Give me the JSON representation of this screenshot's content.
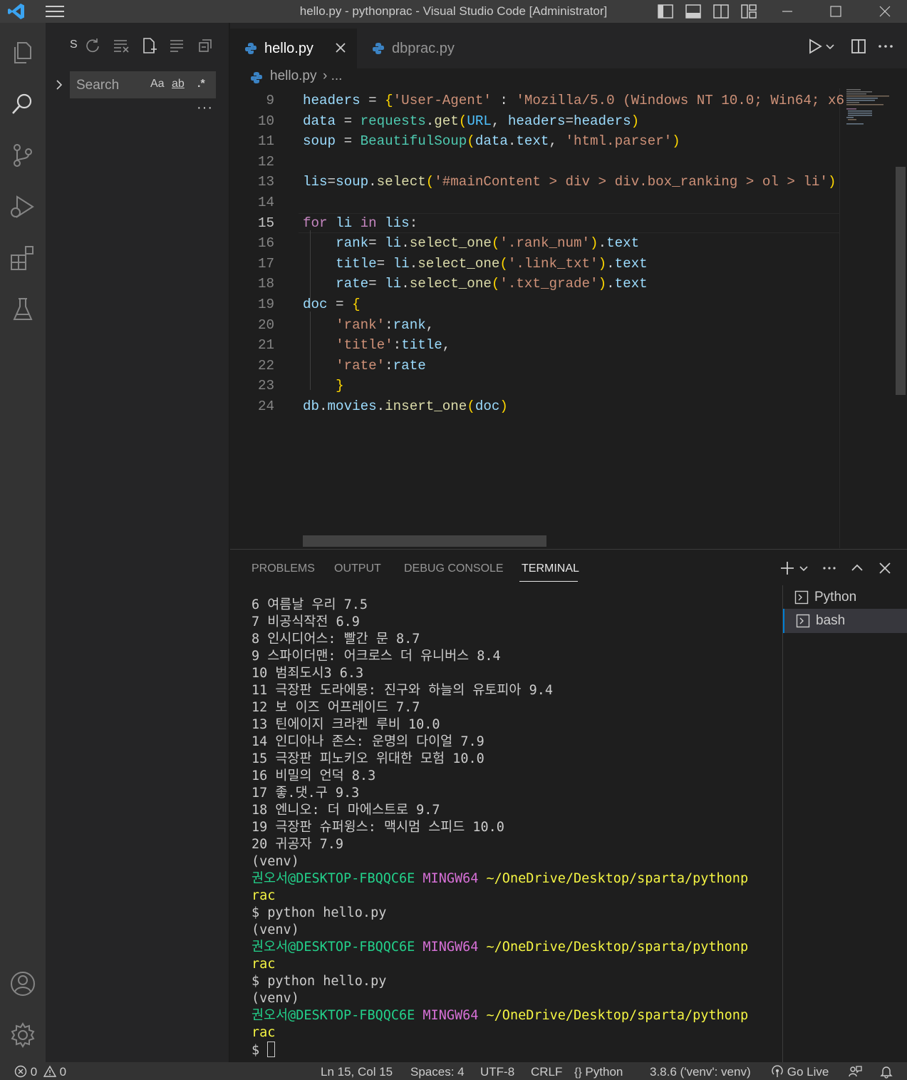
{
  "window": {
    "title": "hello.py - pythonprac - Visual Studio Code [Administrator]"
  },
  "sidebar": {
    "header_letter": "S",
    "search": {
      "placeholder": "Search",
      "value": "",
      "match_case": "Aa",
      "whole_word": "ab",
      "regex": ".*"
    },
    "more": "···"
  },
  "tabs": [
    {
      "label": "hello.py",
      "active": true
    },
    {
      "label": "dbprac.py",
      "active": false
    }
  ],
  "breadcrumb": {
    "file": "hello.py",
    "sep": "› ..."
  },
  "editor": {
    "current_line": 15,
    "lines": [
      {
        "n": "9",
        "tokens": [
          [
            "var",
            "headers"
          ],
          [
            "op",
            " = "
          ],
          [
            "brk1",
            "{"
          ],
          [
            "str",
            "'User-Agent'"
          ],
          [
            "op",
            " : "
          ],
          [
            "str",
            "'Mozilla/5.0 (Windows NT 10.0; Win64; x6"
          ]
        ]
      },
      {
        "n": "10",
        "tokens": [
          [
            "var",
            "data"
          ],
          [
            "op",
            " = "
          ],
          [
            "cls",
            "requests"
          ],
          [
            "op",
            "."
          ],
          [
            "fn",
            "get"
          ],
          [
            "brk1",
            "("
          ],
          [
            "const",
            "URL"
          ],
          [
            "op",
            ", "
          ],
          [
            "var",
            "headers"
          ],
          [
            "op",
            "="
          ],
          [
            "var",
            "headers"
          ],
          [
            "brk1",
            ")"
          ]
        ]
      },
      {
        "n": "11",
        "tokens": [
          [
            "var",
            "soup"
          ],
          [
            "op",
            " = "
          ],
          [
            "cls",
            "BeautifulSoup"
          ],
          [
            "brk1",
            "("
          ],
          [
            "var",
            "data"
          ],
          [
            "op",
            "."
          ],
          [
            "var",
            "text"
          ],
          [
            "op",
            ", "
          ],
          [
            "str",
            "'html.parser'"
          ],
          [
            "brk1",
            ")"
          ]
        ]
      },
      {
        "n": "12",
        "tokens": []
      },
      {
        "n": "13",
        "tokens": [
          [
            "var",
            "lis"
          ],
          [
            "op",
            "="
          ],
          [
            "var",
            "soup"
          ],
          [
            "op",
            "."
          ],
          [
            "fn",
            "select"
          ],
          [
            "brk1",
            "("
          ],
          [
            "str",
            "'#mainContent > div > div.box_ranking > ol > li'"
          ],
          [
            "brk1",
            ")"
          ]
        ]
      },
      {
        "n": "14",
        "tokens": []
      },
      {
        "n": "15",
        "tokens": [
          [
            "kw",
            "for"
          ],
          [
            "op",
            " "
          ],
          [
            "var",
            "li"
          ],
          [
            "op",
            " "
          ],
          [
            "kw",
            "in"
          ],
          [
            "op",
            " "
          ],
          [
            "var",
            "lis"
          ],
          [
            "op",
            ":"
          ]
        ]
      },
      {
        "n": "16",
        "tokens": [
          [
            "op",
            "    "
          ],
          [
            "var",
            "rank"
          ],
          [
            "op",
            "= "
          ],
          [
            "var",
            "li"
          ],
          [
            "op",
            "."
          ],
          [
            "fn",
            "select_one"
          ],
          [
            "brk1",
            "("
          ],
          [
            "str",
            "'.rank_num'"
          ],
          [
            "brk1",
            ")"
          ],
          [
            "op",
            "."
          ],
          [
            "var",
            "text"
          ]
        ]
      },
      {
        "n": "17",
        "tokens": [
          [
            "op",
            "    "
          ],
          [
            "var",
            "title"
          ],
          [
            "op",
            "= "
          ],
          [
            "var",
            "li"
          ],
          [
            "op",
            "."
          ],
          [
            "fn",
            "select_one"
          ],
          [
            "brk1",
            "("
          ],
          [
            "str",
            "'.link_txt'"
          ],
          [
            "brk1",
            ")"
          ],
          [
            "op",
            "."
          ],
          [
            "var",
            "text"
          ]
        ]
      },
      {
        "n": "18",
        "tokens": [
          [
            "op",
            "    "
          ],
          [
            "var",
            "rate"
          ],
          [
            "op",
            "= "
          ],
          [
            "var",
            "li"
          ],
          [
            "op",
            "."
          ],
          [
            "fn",
            "select_one"
          ],
          [
            "brk1",
            "("
          ],
          [
            "str",
            "'.txt_grade'"
          ],
          [
            "brk1",
            ")"
          ],
          [
            "op",
            "."
          ],
          [
            "var",
            "text"
          ]
        ]
      },
      {
        "n": "19",
        "tokens": [
          [
            "var",
            "doc"
          ],
          [
            "op",
            " = "
          ],
          [
            "brk1",
            "{"
          ]
        ]
      },
      {
        "n": "20",
        "tokens": [
          [
            "op",
            "    "
          ],
          [
            "str",
            "'rank'"
          ],
          [
            "op",
            ":"
          ],
          [
            "var",
            "rank"
          ],
          [
            "op",
            ","
          ]
        ]
      },
      {
        "n": "21",
        "tokens": [
          [
            "op",
            "    "
          ],
          [
            "str",
            "'title'"
          ],
          [
            "op",
            ":"
          ],
          [
            "var",
            "title"
          ],
          [
            "op",
            ","
          ]
        ]
      },
      {
        "n": "22",
        "tokens": [
          [
            "op",
            "    "
          ],
          [
            "str",
            "'rate'"
          ],
          [
            "op",
            ":"
          ],
          [
            "var",
            "rate"
          ]
        ]
      },
      {
        "n": "23",
        "tokens": [
          [
            "op",
            "    "
          ],
          [
            "brk1",
            "}"
          ]
        ]
      },
      {
        "n": "24",
        "tokens": [
          [
            "var",
            "db"
          ],
          [
            "op",
            "."
          ],
          [
            "var",
            "movies"
          ],
          [
            "op",
            "."
          ],
          [
            "fn",
            "insert_one"
          ],
          [
            "brk1",
            "("
          ],
          [
            "var",
            "doc"
          ],
          [
            "brk1",
            ")"
          ]
        ]
      }
    ]
  },
  "panel": {
    "tabs": [
      "PROBLEMS",
      "OUTPUT",
      "DEBUG CONSOLE",
      "TERMINAL"
    ],
    "active_tab": "TERMINAL",
    "terminal_lines": [
      [
        [
          "",
          "6 여름날 우리 7.5"
        ]
      ],
      [
        [
          "",
          "7 비공식작전 6.9"
        ]
      ],
      [
        [
          "",
          "8 인시디어스: 빨간 문 8.7"
        ]
      ],
      [
        [
          "",
          "9 스파이더맨: 어크로스 더 유니버스 8.4"
        ]
      ],
      [
        [
          "",
          "10 범죄도시3 6.3"
        ]
      ],
      [
        [
          "",
          "11 극장판 도라에몽: 진구와 하늘의 유토피아 9.4"
        ]
      ],
      [
        [
          "",
          "12 보 이즈 어프레이드 7.7"
        ]
      ],
      [
        [
          "",
          "13 틴에이지 크라켄 루비 10.0"
        ]
      ],
      [
        [
          "",
          "14 인디아나 존스: 운명의 다이얼 7.9"
        ]
      ],
      [
        [
          "",
          "15 극장판 피노키오 위대한 모험 10.0"
        ]
      ],
      [
        [
          "",
          "16 비밀의 언덕 8.3"
        ]
      ],
      [
        [
          "",
          "17 좋.댓.구 9.3"
        ]
      ],
      [
        [
          "",
          "18 엔니오: 더 마에스트로 9.7"
        ]
      ],
      [
        [
          "",
          "19 극장판 슈퍼윙스: 맥시멈 스피드 10.0"
        ]
      ],
      [
        [
          "",
          "20 귀공자 7.9"
        ]
      ],
      [
        [
          "",
          "(venv)"
        ]
      ],
      [
        [
          "t-green",
          "권오서@DESKTOP-FBQQC6E"
        ],
        [
          "",
          " "
        ],
        [
          "t-mag",
          "MINGW64"
        ],
        [
          "",
          " "
        ],
        [
          "t-yel",
          "~/OneDrive/Desktop/sparta/pythonp"
        ]
      ],
      [
        [
          "t-yel",
          "rac"
        ]
      ],
      [
        [
          "",
          "$ python hello.py"
        ]
      ],
      [
        [
          "",
          "(venv)"
        ]
      ],
      [
        [
          "t-green",
          "권오서@DESKTOP-FBQQC6E"
        ],
        [
          "",
          " "
        ],
        [
          "t-mag",
          "MINGW64"
        ],
        [
          "",
          " "
        ],
        [
          "t-yel",
          "~/OneDrive/Desktop/sparta/pythonp"
        ]
      ],
      [
        [
          "t-yel",
          "rac"
        ]
      ],
      [
        [
          "",
          "$ python hello.py"
        ]
      ],
      [
        [
          "",
          "(venv)"
        ]
      ],
      [
        [
          "t-green",
          "권오서@DESKTOP-FBQQC6E"
        ],
        [
          "",
          " "
        ],
        [
          "t-mag",
          "MINGW64"
        ],
        [
          "",
          " "
        ],
        [
          "t-yel",
          "~/OneDrive/Desktop/sparta/pythonp"
        ]
      ],
      [
        [
          "t-yel",
          "rac"
        ]
      ],
      [
        [
          "",
          "$ "
        ]
      ]
    ],
    "terminals": [
      {
        "label": "Python",
        "selected": false
      },
      {
        "label": "bash",
        "selected": true
      }
    ]
  },
  "statusbar": {
    "errors": "0",
    "warnings": "0",
    "position": "Ln 15, Col 15",
    "spaces": "Spaces: 4",
    "encoding": "UTF-8",
    "eol": "CRLF",
    "language": "Python",
    "interpreter": "3.8.6 ('venv': venv)",
    "go_live": "Go Live"
  },
  "colors": {
    "accent": "#007fd4",
    "titlebar": "#3c3c3c",
    "activitybar": "#333333",
    "sidebar": "#252526",
    "editor": "#1e1e1e"
  }
}
